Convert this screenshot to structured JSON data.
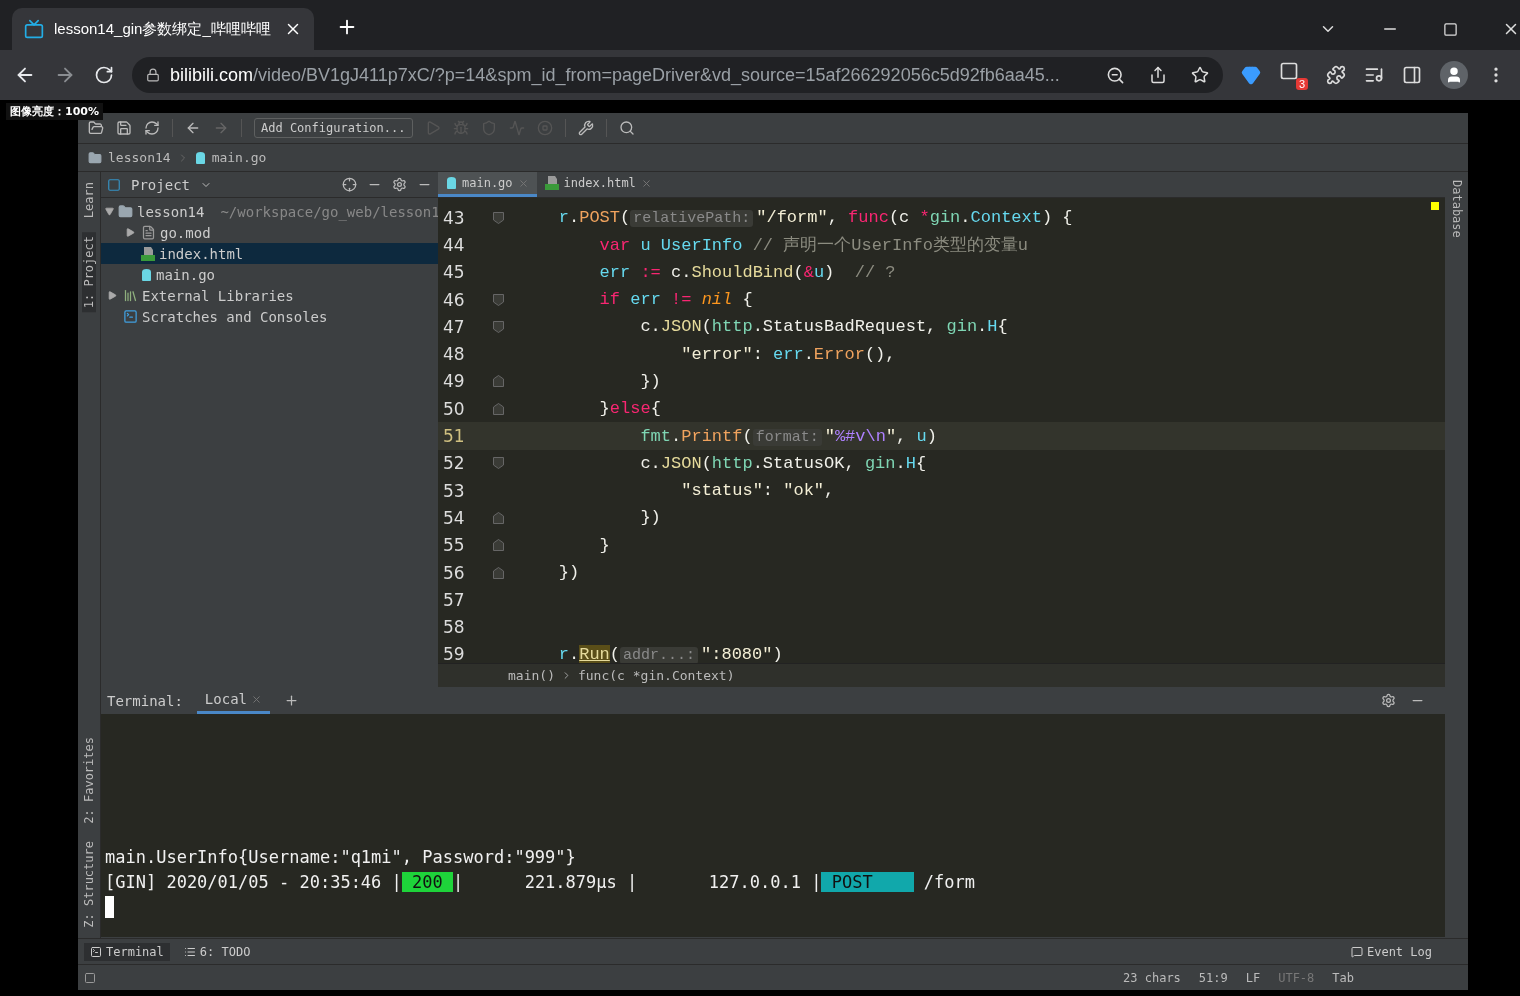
{
  "browser": {
    "tab": {
      "title": "lesson14_gin参数绑定_哔哩哔哩",
      "selected": true
    },
    "url": {
      "host": "bilibili.com",
      "path": "/video/BV1gJ411p7xC/?p=14&spm_id_from=pageDriver&vd_source=15af266292056c5d92fb6aa45..."
    },
    "extension_badge": "3"
  },
  "overlay_label": "图像亮度：100%",
  "ide": {
    "run_config": "Add Configuration...",
    "nav_path": [
      "lesson14",
      "main.go"
    ],
    "left_stripe_top": [
      "Learn",
      "1: Project"
    ],
    "left_stripe_bottom": [
      "2: Favorites",
      "Z: Structure"
    ],
    "right_stripe": [
      "Database"
    ],
    "project": {
      "title": "Project",
      "tree": [
        {
          "name": "lesson14",
          "path": "~/workspace/go_web/lesson1",
          "kind": "folder",
          "expanded": true,
          "selected": false,
          "children": [
            {
              "name": "go.mod",
              "kind": "file",
              "expanded": false,
              "selected": false
            },
            {
              "name": "index.html",
              "kind": "html",
              "selected": true
            },
            {
              "name": "main.go",
              "kind": "go",
              "selected": false
            }
          ]
        },
        {
          "name": "External Libraries",
          "kind": "libraries",
          "expanded": false,
          "selected": false
        },
        {
          "name": "Scratches and Consoles",
          "kind": "scratches",
          "selected": false
        }
      ]
    },
    "editor_tabs": [
      {
        "label": "main.go",
        "kind": "go",
        "selected": true
      },
      {
        "label": "index.html",
        "kind": "html",
        "selected": false
      }
    ],
    "code": [
      {
        "number": "43",
        "kind": "fold-open",
        "current": false,
        "tokens": [
          {
            "text": "    r",
            "kind": "ident"
          },
          {
            "text": ".",
            "kind": "plain"
          },
          {
            "text": "POST",
            "kind": "method"
          },
          {
            "text": "(",
            "kind": "plain"
          },
          {
            "text": "relativePath:",
            "kind": "hint"
          },
          {
            "text": "\"/form\"",
            "kind": "str"
          },
          {
            "text": ", ",
            "kind": "plain"
          },
          {
            "text": "func",
            "kind": "kw"
          },
          {
            "text": "(c ",
            "kind": "plain"
          },
          {
            "text": "*",
            "kind": "kw"
          },
          {
            "text": "gin",
            "kind": "pkg"
          },
          {
            "text": ".",
            "kind": "plain"
          },
          {
            "text": "Context",
            "kind": "type"
          },
          {
            "text": ") {",
            "kind": "plain"
          }
        ]
      },
      {
        "number": "44",
        "kind": "plain",
        "current": false,
        "tokens": [
          {
            "text": "        var",
            "kind": "kw"
          },
          {
            "text": " u ",
            "kind": "ident"
          },
          {
            "text": "UserInfo",
            "kind": "type"
          },
          {
            "text": " // 声明一个UserInfo类型的变量u",
            "kind": "comment"
          }
        ]
      },
      {
        "number": "45",
        "kind": "plain",
        "current": false,
        "tokens": [
          {
            "text": "        err",
            "kind": "ident"
          },
          {
            "text": " := ",
            "kind": "kw"
          },
          {
            "text": "c.",
            "kind": "plain"
          },
          {
            "text": "ShouldBind",
            "kind": "call"
          },
          {
            "text": "(",
            "kind": "plain"
          },
          {
            "text": "&",
            "kind": "kw"
          },
          {
            "text": "u",
            "kind": "ident"
          },
          {
            "text": ")",
            "kind": "plain"
          },
          {
            "text": "  // ?",
            "kind": "comment"
          }
        ]
      },
      {
        "number": "46",
        "kind": "fold-open",
        "current": false,
        "tokens": [
          {
            "text": "        if",
            "kind": "kw"
          },
          {
            "text": " err ",
            "kind": "ident"
          },
          {
            "text": "!= ",
            "kind": "kw"
          },
          {
            "text": "nil",
            "kind": "nil"
          },
          {
            "text": " {",
            "kind": "plain"
          }
        ]
      },
      {
        "number": "47",
        "kind": "fold-open",
        "current": false,
        "tokens": [
          {
            "text": "            c.",
            "kind": "plain"
          },
          {
            "text": "JSON",
            "kind": "call"
          },
          {
            "text": "(",
            "kind": "plain"
          },
          {
            "text": "http",
            "kind": "pkg"
          },
          {
            "text": ".StatusBadRequest, ",
            "kind": "plain"
          },
          {
            "text": "gin",
            "kind": "pkg"
          },
          {
            "text": ".",
            "kind": "plain"
          },
          {
            "text": "H",
            "kind": "type"
          },
          {
            "text": "{",
            "kind": "plain"
          }
        ]
      },
      {
        "number": "48",
        "kind": "plain",
        "current": false,
        "tokens": [
          {
            "text": "                \"error\"",
            "kind": "str"
          },
          {
            "text": ": ",
            "kind": "plain"
          },
          {
            "text": "err",
            "kind": "ident"
          },
          {
            "text": ".",
            "kind": "plain"
          },
          {
            "text": "Error",
            "kind": "method"
          },
          {
            "text": "(),",
            "kind": "plain"
          }
        ]
      },
      {
        "number": "49",
        "kind": "fold-close",
        "current": false,
        "tokens": [
          {
            "text": "            })",
            "kind": "plain"
          }
        ]
      },
      {
        "number": "50",
        "kind": "fold-close",
        "current": false,
        "tokens": [
          {
            "text": "        }",
            "kind": "plain"
          },
          {
            "text": "else",
            "kind": "kw"
          },
          {
            "text": "{",
            "kind": "plain"
          }
        ]
      },
      {
        "number": "51",
        "kind": "plain",
        "current": true,
        "tokens": [
          {
            "text": "            fmt",
            "kind": "pkg"
          },
          {
            "text": ".",
            "kind": "plain"
          },
          {
            "text": "Printf",
            "kind": "method"
          },
          {
            "text": "(",
            "kind": "plain"
          },
          {
            "text": "format:",
            "kind": "hint"
          },
          {
            "text": "\"",
            "kind": "str"
          },
          {
            "text": "%#v\\n",
            "kind": "escape"
          },
          {
            "text": "\"",
            "kind": "str"
          },
          {
            "text": ", ",
            "kind": "plain"
          },
          {
            "text": "u",
            "kind": "ident"
          },
          {
            "text": ")",
            "kind": "plain"
          }
        ]
      },
      {
        "number": "52",
        "kind": "fold-open",
        "current": false,
        "tokens": [
          {
            "text": "            c.",
            "kind": "plain"
          },
          {
            "text": "JSON",
            "kind": "call"
          },
          {
            "text": "(",
            "kind": "plain"
          },
          {
            "text": "http",
            "kind": "pkg"
          },
          {
            "text": ".StatusOK, ",
            "kind": "plain"
          },
          {
            "text": "gin",
            "kind": "pkg"
          },
          {
            "text": ".",
            "kind": "plain"
          },
          {
            "text": "H",
            "kind": "type"
          },
          {
            "text": "{",
            "kind": "plain"
          }
        ]
      },
      {
        "number": "53",
        "kind": "plain",
        "current": false,
        "tokens": [
          {
            "text": "                \"status\"",
            "kind": "str"
          },
          {
            "text": ": ",
            "kind": "plain"
          },
          {
            "text": "\"ok\"",
            "kind": "str"
          },
          {
            "text": ",",
            "kind": "plain"
          }
        ]
      },
      {
        "number": "54",
        "kind": "fold-close",
        "current": false,
        "tokens": [
          {
            "text": "            })",
            "kind": "plain"
          }
        ]
      },
      {
        "number": "55",
        "kind": "fold-close",
        "current": false,
        "tokens": [
          {
            "text": "        }",
            "kind": "plain"
          }
        ]
      },
      {
        "number": "56",
        "kind": "fold-close",
        "current": false,
        "tokens": [
          {
            "text": "    })",
            "kind": "plain"
          }
        ]
      },
      {
        "number": "57",
        "kind": "plain",
        "current": false
      },
      {
        "number": "58",
        "kind": "plain",
        "current": false
      },
      {
        "number": "59",
        "kind": "plain",
        "current": false,
        "tokens": [
          {
            "text": "    r",
            "kind": "ident"
          },
          {
            "text": ".",
            "kind": "plain"
          },
          {
            "text": "Run",
            "kind": "warn"
          },
          {
            "text": "(",
            "kind": "plain"
          },
          {
            "text": "addr...:",
            "kind": "hint"
          },
          {
            "text": "\":8080\"",
            "kind": "str"
          },
          {
            "text": ")",
            "kind": "plain"
          }
        ]
      }
    ],
    "code_breadcrumb": [
      "main()",
      "func(c *gin.Context)"
    ],
    "terminal": {
      "title": "Terminal:",
      "tabs": [
        {
          "label": "Local",
          "selected": true
        }
      ],
      "lines": [
        {
          "segments": [
            {
              "text": "main.UserInfo{Username:\"q1mi\", Password:\"999\"}",
              "kind": "text"
            }
          ]
        },
        {
          "segments": [
            {
              "text": "[GIN] 2020/01/05 - 20:35:46 |",
              "kind": "text"
            },
            {
              "text": " 200 ",
              "kind": "badge",
              "color": "#1ed43a"
            },
            {
              "text": "|      221.879µs |       127.0.0.1 |",
              "kind": "text"
            },
            {
              "text": " POST    ",
              "kind": "badge",
              "color": "#11a8ab"
            },
            {
              "text": " /form",
              "kind": "text"
            }
          ]
        }
      ],
      "cursor": true
    },
    "tool_tabs": [
      {
        "label": "Terminal",
        "kind": "terminal",
        "selected": true
      },
      {
        "label": "6: TODO",
        "kind": "todo",
        "selected": false
      }
    ],
    "event_log": "Event Log",
    "status": [
      {
        "text": "23 chars",
        "dim": false
      },
      {
        "text": "51:9",
        "dim": false
      },
      {
        "text": "LF",
        "dim": false
      },
      {
        "text": "UTF-8",
        "dim": true
      },
      {
        "text": "Tab",
        "dim": false
      }
    ]
  }
}
